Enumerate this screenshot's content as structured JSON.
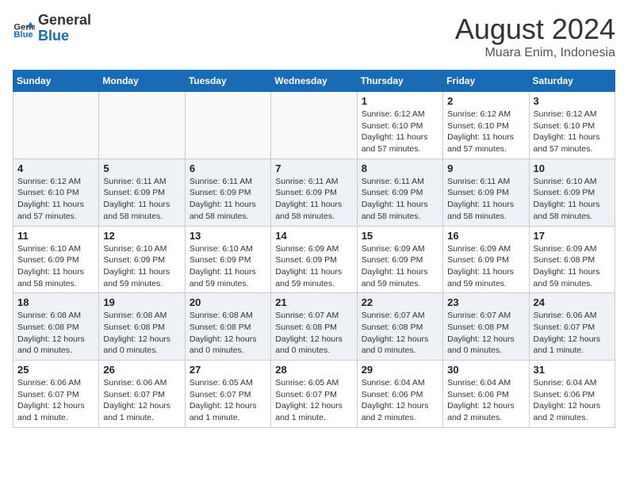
{
  "header": {
    "logo_general": "General",
    "logo_blue": "Blue",
    "month_title": "August 2024",
    "location": "Muara Enim, Indonesia"
  },
  "days_of_week": [
    "Sunday",
    "Monday",
    "Tuesday",
    "Wednesday",
    "Thursday",
    "Friday",
    "Saturday"
  ],
  "weeks": [
    [
      {
        "day": "",
        "empty": true
      },
      {
        "day": "",
        "empty": true
      },
      {
        "day": "",
        "empty": true
      },
      {
        "day": "",
        "empty": true
      },
      {
        "day": "1",
        "sunrise": "6:12 AM",
        "sunset": "6:10 PM",
        "daylight": "11 hours and 57 minutes."
      },
      {
        "day": "2",
        "sunrise": "6:12 AM",
        "sunset": "6:10 PM",
        "daylight": "11 hours and 57 minutes."
      },
      {
        "day": "3",
        "sunrise": "6:12 AM",
        "sunset": "6:10 PM",
        "daylight": "11 hours and 57 minutes."
      }
    ],
    [
      {
        "day": "4",
        "sunrise": "6:12 AM",
        "sunset": "6:10 PM",
        "daylight": "11 hours and 57 minutes."
      },
      {
        "day": "5",
        "sunrise": "6:11 AM",
        "sunset": "6:09 PM",
        "daylight": "11 hours and 58 minutes."
      },
      {
        "day": "6",
        "sunrise": "6:11 AM",
        "sunset": "6:09 PM",
        "daylight": "11 hours and 58 minutes."
      },
      {
        "day": "7",
        "sunrise": "6:11 AM",
        "sunset": "6:09 PM",
        "daylight": "11 hours and 58 minutes."
      },
      {
        "day": "8",
        "sunrise": "6:11 AM",
        "sunset": "6:09 PM",
        "daylight": "11 hours and 58 minutes."
      },
      {
        "day": "9",
        "sunrise": "6:11 AM",
        "sunset": "6:09 PM",
        "daylight": "11 hours and 58 minutes."
      },
      {
        "day": "10",
        "sunrise": "6:10 AM",
        "sunset": "6:09 PM",
        "daylight": "11 hours and 58 minutes."
      }
    ],
    [
      {
        "day": "11",
        "sunrise": "6:10 AM",
        "sunset": "6:09 PM",
        "daylight": "11 hours and 58 minutes."
      },
      {
        "day": "12",
        "sunrise": "6:10 AM",
        "sunset": "6:09 PM",
        "daylight": "11 hours and 59 minutes."
      },
      {
        "day": "13",
        "sunrise": "6:10 AM",
        "sunset": "6:09 PM",
        "daylight": "11 hours and 59 minutes."
      },
      {
        "day": "14",
        "sunrise": "6:09 AM",
        "sunset": "6:09 PM",
        "daylight": "11 hours and 59 minutes."
      },
      {
        "day": "15",
        "sunrise": "6:09 AM",
        "sunset": "6:09 PM",
        "daylight": "11 hours and 59 minutes."
      },
      {
        "day": "16",
        "sunrise": "6:09 AM",
        "sunset": "6:09 PM",
        "daylight": "11 hours and 59 minutes."
      },
      {
        "day": "17",
        "sunrise": "6:09 AM",
        "sunset": "6:08 PM",
        "daylight": "11 hours and 59 minutes."
      }
    ],
    [
      {
        "day": "18",
        "sunrise": "6:08 AM",
        "sunset": "6:08 PM",
        "daylight": "12 hours and 0 minutes."
      },
      {
        "day": "19",
        "sunrise": "6:08 AM",
        "sunset": "6:08 PM",
        "daylight": "12 hours and 0 minutes."
      },
      {
        "day": "20",
        "sunrise": "6:08 AM",
        "sunset": "6:08 PM",
        "daylight": "12 hours and 0 minutes."
      },
      {
        "day": "21",
        "sunrise": "6:07 AM",
        "sunset": "6:08 PM",
        "daylight": "12 hours and 0 minutes."
      },
      {
        "day": "22",
        "sunrise": "6:07 AM",
        "sunset": "6:08 PM",
        "daylight": "12 hours and 0 minutes."
      },
      {
        "day": "23",
        "sunrise": "6:07 AM",
        "sunset": "6:08 PM",
        "daylight": "12 hours and 0 minutes."
      },
      {
        "day": "24",
        "sunrise": "6:06 AM",
        "sunset": "6:07 PM",
        "daylight": "12 hours and 1 minute."
      }
    ],
    [
      {
        "day": "25",
        "sunrise": "6:06 AM",
        "sunset": "6:07 PM",
        "daylight": "12 hours and 1 minute."
      },
      {
        "day": "26",
        "sunrise": "6:06 AM",
        "sunset": "6:07 PM",
        "daylight": "12 hours and 1 minute."
      },
      {
        "day": "27",
        "sunrise": "6:05 AM",
        "sunset": "6:07 PM",
        "daylight": "12 hours and 1 minute."
      },
      {
        "day": "28",
        "sunrise": "6:05 AM",
        "sunset": "6:07 PM",
        "daylight": "12 hours and 1 minute."
      },
      {
        "day": "29",
        "sunrise": "6:04 AM",
        "sunset": "6:06 PM",
        "daylight": "12 hours and 2 minutes."
      },
      {
        "day": "30",
        "sunrise": "6:04 AM",
        "sunset": "6:06 PM",
        "daylight": "12 hours and 2 minutes."
      },
      {
        "day": "31",
        "sunrise": "6:04 AM",
        "sunset": "6:06 PM",
        "daylight": "12 hours and 2 minutes."
      }
    ]
  ]
}
